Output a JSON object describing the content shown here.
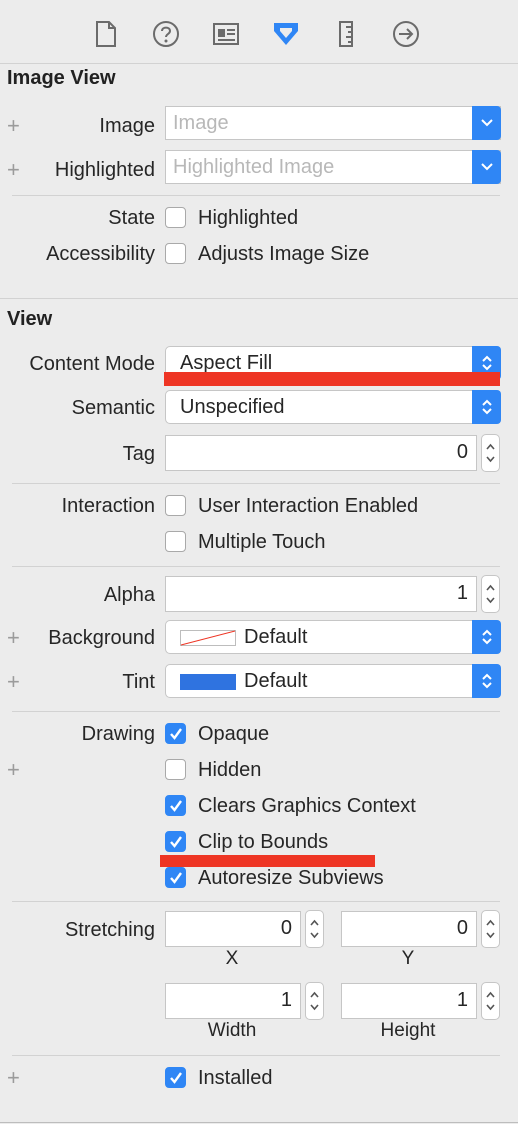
{
  "toolbar": {
    "icons": [
      "file-icon",
      "help-icon",
      "identity-icon",
      "attributes-icon",
      "ruler-icon",
      "connections-icon"
    ]
  },
  "image_view": {
    "title": "Image View",
    "image_label": "Image",
    "image_placeholder": "Image",
    "highlighted_label": "Highlighted",
    "highlighted_placeholder": "Highlighted Image",
    "state_label": "State",
    "state_checkbox": "Highlighted",
    "accessibility_label": "Accessibility",
    "accessibility_checkbox": "Adjusts Image Size"
  },
  "view": {
    "title": "View",
    "content_mode_label": "Content Mode",
    "content_mode_value": "Aspect Fill",
    "semantic_label": "Semantic",
    "semantic_value": "Unspecified",
    "tag_label": "Tag",
    "tag_value": "0",
    "interaction_label": "Interaction",
    "user_interaction": "User Interaction Enabled",
    "multiple_touch": "Multiple Touch",
    "alpha_label": "Alpha",
    "alpha_value": "1",
    "background_label": "Background",
    "background_value": "Default",
    "tint_label": "Tint",
    "tint_value": "Default",
    "tint_color": "#2f73e0",
    "drawing_label": "Drawing",
    "opaque": "Opaque",
    "hidden": "Hidden",
    "clears_graphics": "Clears Graphics Context",
    "clip_to_bounds": "Clip to Bounds",
    "autoresize": "Autoresize Subviews",
    "stretching_label": "Stretching",
    "stretch_x_value": "0",
    "stretch_y_value": "0",
    "stretch_w_value": "1",
    "stretch_h_value": "1",
    "x_label": "X",
    "y_label": "Y",
    "width_label": "Width",
    "height_label": "Height",
    "installed": "Installed"
  },
  "checkbox_states": {
    "highlighted": false,
    "adjusts_image_size": false,
    "user_interaction": false,
    "multiple_touch": false,
    "opaque": true,
    "hidden": false,
    "clears_graphics": true,
    "clip_to_bounds": true,
    "autoresize": true,
    "installed": true
  },
  "colors": {
    "accent": "#2f86f5",
    "annotation_red": "#ee3524"
  }
}
